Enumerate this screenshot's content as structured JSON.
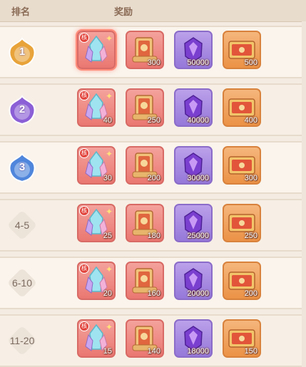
{
  "header": {
    "rank_label": "排名",
    "reward_label": "奖励"
  },
  "badge_text": "核",
  "rows": [
    {
      "rank": "1",
      "rank_type": "gold",
      "qty": [
        "",
        "300",
        "50000",
        "500"
      ],
      "highlight": true
    },
    {
      "rank": "2",
      "rank_type": "purple",
      "qty": [
        "40",
        "250",
        "40000",
        "400"
      ]
    },
    {
      "rank": "3",
      "rank_type": "blue",
      "qty": [
        "30",
        "200",
        "30000",
        "300"
      ]
    },
    {
      "rank": "4-5",
      "rank_type": "plain",
      "qty": [
        "25",
        "180",
        "25000",
        "250"
      ]
    },
    {
      "rank": "6-10",
      "rank_type": "plain",
      "qty": [
        "20",
        "160",
        "20000",
        "200"
      ]
    },
    {
      "rank": "11-20",
      "rank_type": "plain",
      "qty": [
        "15",
        "140",
        "18000",
        "150"
      ]
    }
  ],
  "items": [
    {
      "name": "crystal-core",
      "frame": "red"
    },
    {
      "name": "scroll-book",
      "frame": "red"
    },
    {
      "name": "purple-gem",
      "frame": "purple"
    },
    {
      "name": "ticket",
      "frame": "orange"
    }
  ],
  "colors": {
    "gold": "#e8a33a",
    "purple": "#8b5fd6",
    "blue": "#4f86dc"
  }
}
